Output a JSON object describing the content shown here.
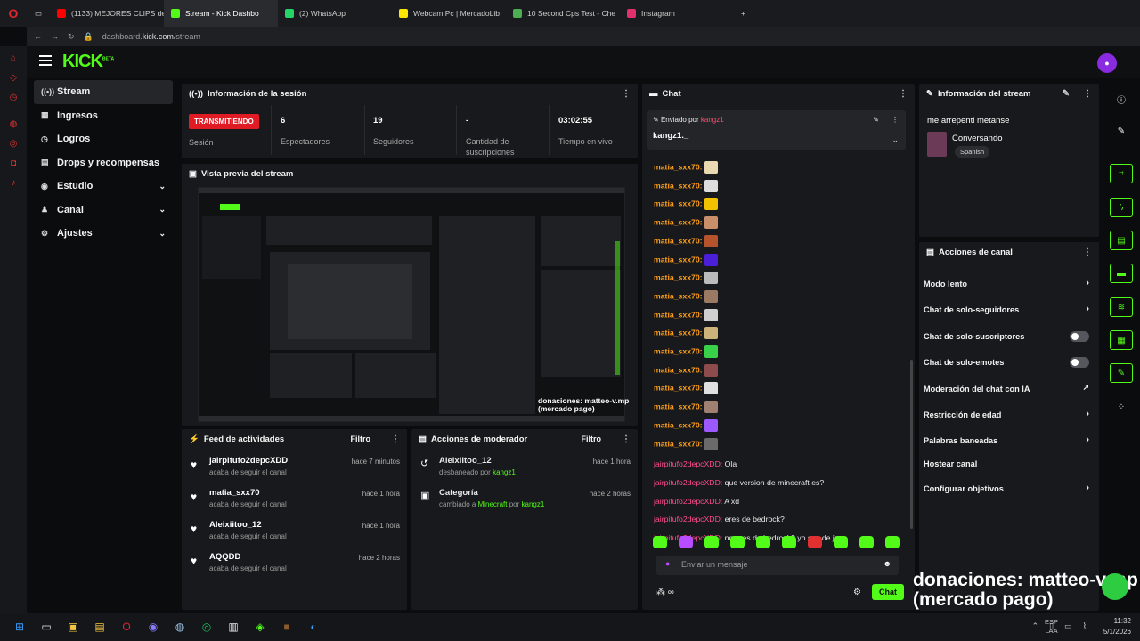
{
  "browser": {
    "tabs": [
      {
        "label": "(1133) MEJORES CLIPS de",
        "color": "#ff0000",
        "active": false
      },
      {
        "label": "Stream - Kick Dashbo",
        "color": "#53fc18",
        "active": true
      },
      {
        "label": "(2) WhatsApp",
        "color": "#25d366",
        "active": false
      },
      {
        "label": "Webcam Pc | MercadoLib",
        "color": "#ffe600",
        "active": false
      },
      {
        "label": "10 Second Cps Test - Che",
        "color": "#4caf50",
        "active": false
      },
      {
        "label": "Instagram",
        "color": "#e1306c",
        "active": false
      }
    ],
    "new_tab": "+",
    "url_prefix": "dashboard.",
    "url_domain": "kick.com",
    "url_path": "/stream"
  },
  "header": {
    "logo": "KICK",
    "logo_sup": "BETA"
  },
  "nav": {
    "items": [
      {
        "label": "Stream",
        "icon": "((•))",
        "active": true,
        "chev": ""
      },
      {
        "label": "Ingresos",
        "icon": "▦",
        "active": false,
        "chev": ""
      },
      {
        "label": "Logros",
        "icon": "◷",
        "active": false,
        "chev": ""
      },
      {
        "label": "Drops y recompensas",
        "icon": "▤",
        "active": false,
        "chev": ""
      },
      {
        "label": "Estudio",
        "icon": "◉",
        "active": false,
        "chev": "⌄"
      },
      {
        "label": "Canal",
        "icon": "♟",
        "active": false,
        "chev": "⌄"
      },
      {
        "label": "Ajustes",
        "icon": "⚙",
        "active": false,
        "chev": "⌄"
      }
    ]
  },
  "session": {
    "title": "Información de la sesión",
    "badge": "TRANSMITIENDO",
    "badge_label": "Sesión",
    "stats": [
      {
        "value": "6",
        "label": "Espectadores"
      },
      {
        "value": "19",
        "label": "Seguidores"
      },
      {
        "value": "-",
        "label": "Cantidad de suscripciones"
      },
      {
        "value": "03:02:55",
        "label": "Tiempo en vivo"
      }
    ]
  },
  "preview": {
    "title": "Vista previa del stream"
  },
  "overlay": {
    "donation_line1": "donaciones: matteo-v.mp",
    "donation_line2": "(mercado pago)"
  },
  "activity": {
    "title": "Feed de actividades",
    "filter": "Filtro",
    "items": [
      {
        "name": "jairpitufo2depcXDD",
        "sub": "acaba de seguir el canal",
        "time": "hace 7 minutos"
      },
      {
        "name": "matia_sxx70",
        "sub": "acaba de seguir el canal",
        "time": "hace 1 hora"
      },
      {
        "name": "Aleixiitoo_12",
        "sub": "acaba de seguir el canal",
        "time": "hace 1 hora"
      },
      {
        "name": "AQQDD",
        "sub": "acaba de seguir el canal",
        "time": "hace 2 horas"
      }
    ]
  },
  "modactions": {
    "title": "Acciones de moderador",
    "filter": "Filtro",
    "items": [
      {
        "name": "Aleixiitoo_12",
        "sub_pre": "desbaneado por ",
        "sub_mid": "",
        "sub_by": "kangz1",
        "time": "hace 1 hora",
        "icon": "↺"
      },
      {
        "name": "Categoría",
        "sub_pre": "cambiado a ",
        "sub_mid": "Minecraft",
        "sub_by": "kangz1",
        "time": "hace 2 horas",
        "icon": "▣"
      }
    ]
  },
  "chat": {
    "title": "Chat",
    "pinned_by_label": "Enviado por",
    "pinned_by_user": "kangz1",
    "pinned_message": "kangz1._",
    "emote_messages": [
      {
        "user": "matia_sxx70:",
        "color": "#e8d9b0"
      },
      {
        "user": "matia_sxx70:",
        "color": "#dddddd"
      },
      {
        "user": "matia_sxx70:",
        "color": "#f2c200"
      },
      {
        "user": "matia_sxx70:",
        "color": "#c98f6b"
      },
      {
        "user": "matia_sxx70:",
        "color": "#b5542c"
      },
      {
        "user": "matia_sxx70:",
        "color": "#4b1fd8"
      },
      {
        "user": "matia_sxx70:",
        "color": "#bbbbbb"
      },
      {
        "user": "matia_sxx70:",
        "color": "#9a7a62"
      },
      {
        "user": "matia_sxx70:",
        "color": "#cfcfcf"
      },
      {
        "user": "matia_sxx70:",
        "color": "#ccb37a"
      },
      {
        "user": "matia_sxx70:",
        "color": "#3ad14a"
      },
      {
        "user": "matia_sxx70:",
        "color": "#8e4b4b"
      },
      {
        "user": "matia_sxx70:",
        "color": "#e0e0e0"
      },
      {
        "user": "matia_sxx70:",
        "color": "#a08070"
      },
      {
        "user": "matia_sxx70:",
        "color": "#9b59ff"
      },
      {
        "user": "matia_sxx70:",
        "color": "#6a6a6a"
      }
    ],
    "text_messages": [
      {
        "user": "jairpitufo2depcXDD:",
        "text": " Ola"
      },
      {
        "user": "jairpitufo2depcXDD:",
        "text": " que version de minecraft es?"
      },
      {
        "user": "jairpitufo2depcXDD:",
        "text": " A xd"
      },
      {
        "user": "jairpitufo2depcXDD:",
        "text": " eres de bedrock?"
      },
      {
        "user": "jairpitufo2depcXDD:",
        "text": " no eres de bedrock? yo soy de java"
      }
    ],
    "emote_bar": [
      "#53fc18",
      "#b84dff",
      "#53fc18",
      "#53fc18",
      "#53fc18",
      "#53fc18",
      "#e03030",
      "#53fc18",
      "#53fc18",
      "#53fc18"
    ],
    "input_placeholder": "Enviar un mensaje",
    "send_label": "Chat"
  },
  "streaminfo": {
    "title": "Información del stream",
    "stream_title": "me arrepenti metanse",
    "category": "Conversando",
    "language": "Spanish"
  },
  "channelactions": {
    "title": "Acciones de canal",
    "items": [
      {
        "label": "Modo lento",
        "kind": "arrow"
      },
      {
        "label": "Chat de solo-seguidores",
        "kind": "arrow"
      },
      {
        "label": "Chat de solo-suscriptores",
        "kind": "toggle"
      },
      {
        "label": "Chat de solo-emotes",
        "kind": "toggle"
      },
      {
        "label": "Moderación del chat con IA",
        "kind": "external"
      },
      {
        "label": "Restricción de edad",
        "kind": "arrow"
      },
      {
        "label": "Palabras baneadas",
        "kind": "arrow"
      },
      {
        "label": "Hostear canal",
        "kind": "none"
      },
      {
        "label": "Configurar objetivos",
        "kind": "arrow"
      }
    ]
  },
  "taskbar": {
    "lang": "ESP",
    "lang2": "LAA",
    "time": "11:32",
    "date": "5/1/2026"
  }
}
